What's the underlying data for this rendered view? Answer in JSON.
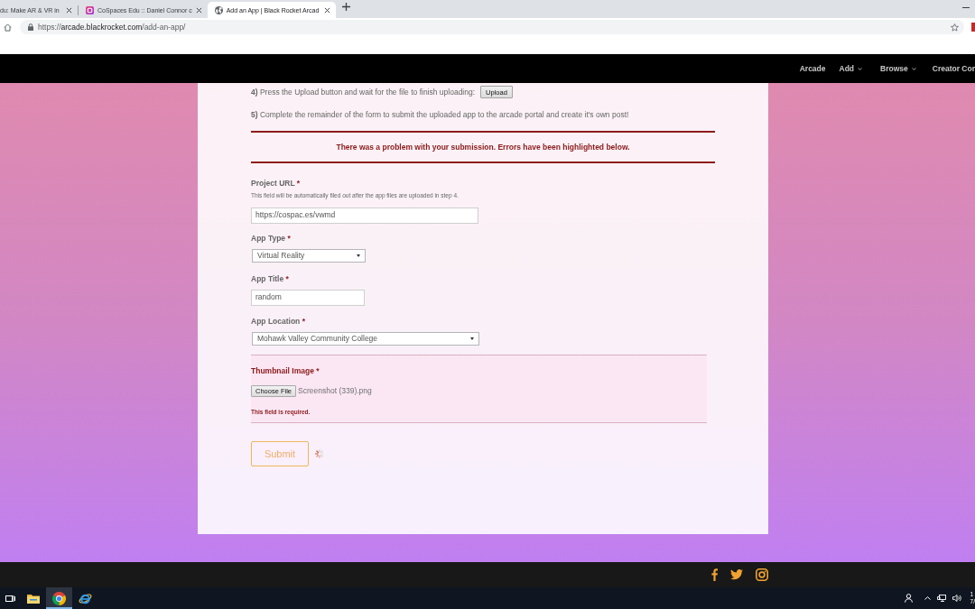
{
  "browser": {
    "tabs": [
      {
        "kind": "clipped",
        "title": "du: Make AR & VR in",
        "selected": false
      },
      {
        "kind": "app",
        "title": "CoSpaces Edu :: Daniel Connor c",
        "selected": false
      },
      {
        "kind": "page",
        "title": "Add an App | Black Rocket Arcad",
        "selected": true
      }
    ],
    "address": {
      "scheme": "https://",
      "host": "arcade.blackrocket.com",
      "path": "/add-an-app/"
    }
  },
  "site_nav": [
    {
      "label": "Arcade",
      "has_menu": false
    },
    {
      "label": "Add",
      "has_menu": true
    },
    {
      "label": "Browse",
      "has_menu": true
    },
    {
      "label": "Creator Cor",
      "has_menu": false
    }
  ],
  "form": {
    "steps": [
      {
        "text": "**4)** Press the Upload button and wait for the file to finish uploading:",
        "button": "Upload"
      },
      {
        "text": "**5)** Complete the remainder of the form to submit the uploaded app to the arcade portal and create it's own post!"
      }
    ],
    "error_banner": "There was a problem with your submission. Errors have been highlighted below.",
    "fields": [
      {
        "kind": "text",
        "label": "Project URL",
        "required_mark": "*",
        "description": "This field will be automatically filed out after the app files are uploaded in step 4.",
        "value": "https://cospac.es/vwmd",
        "invalid": false
      },
      {
        "kind": "select",
        "label": "App Type",
        "required_mark": "*",
        "value": "Virtual Reality",
        "invalid": false
      },
      {
        "kind": "text",
        "label": "App Title",
        "required_mark": "*",
        "value": "random",
        "invalid": false
      },
      {
        "kind": "select",
        "label": "App Location",
        "required_mark": "*",
        "value": "Mohawk Valley Community College",
        "invalid": false
      },
      {
        "kind": "file",
        "label": "Thumbnail Image",
        "required_mark": "*",
        "button": "Choose File",
        "value": "Screenshot (339).png",
        "invalid": true,
        "error": "This field is required."
      }
    ],
    "submit": {
      "label": "Submit",
      "loading": true
    }
  },
  "taskbar": {
    "apps": [
      {
        "kind": "file-explorer",
        "selected": false
      },
      {
        "kind": "chrome",
        "selected": true
      },
      {
        "kind": "internet-explorer",
        "selected": false
      }
    ],
    "clock": {
      "time": "1",
      "date": "7/"
    }
  }
}
